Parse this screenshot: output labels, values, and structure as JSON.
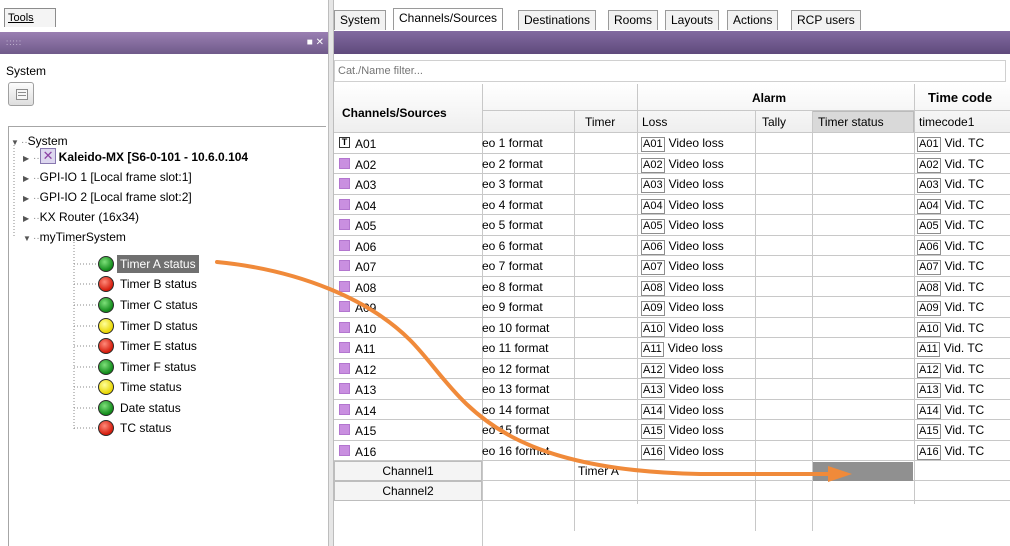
{
  "left_panel": {
    "tools_label": "Tools",
    "system_label": "System",
    "tree": {
      "root": "System",
      "items": [
        {
          "label": "Kaleido-MX [S6-0-101 - 10.6.0.104",
          "bold": true
        },
        {
          "label": "GPI-IO 1 [Local frame slot:1]"
        },
        {
          "label": "GPI-IO 2 [Local frame slot:2]"
        },
        {
          "label": "KX Router (16x34)"
        },
        {
          "label": "myTimerSystem"
        }
      ],
      "timers": [
        {
          "label": "Timer A status",
          "color": "green",
          "selected": true
        },
        {
          "label": "Timer B status",
          "color": "red"
        },
        {
          "label": "Timer C status",
          "color": "green"
        },
        {
          "label": "Timer D status",
          "color": "yellow"
        },
        {
          "label": "Timer E status",
          "color": "red"
        },
        {
          "label": "Timer F status",
          "color": "green"
        },
        {
          "label": "Time status",
          "color": "yellow"
        },
        {
          "label": "Date status",
          "color": "green"
        },
        {
          "label": "TC status",
          "color": "red"
        }
      ]
    }
  },
  "tabs": [
    "System",
    "Channels/Sources",
    "Destinations",
    "Rooms",
    "Layouts",
    "Actions",
    "RCP users"
  ],
  "active_tab": "Channels/Sources",
  "filter_placeholder": "Cat./Name filter...",
  "grid": {
    "headers": {
      "channels": "Channels/Sources",
      "alarm": "Alarm",
      "time_code": "Time code",
      "timer": "Timer",
      "loss": "Loss",
      "tally": "Tally",
      "timer_status": "Timer status",
      "timecode1": "timecode1"
    },
    "rows": [
      {
        "channel": "A01",
        "icon": "T",
        "format": "eo 1 format",
        "loss_id": "A01",
        "loss": "Video loss",
        "tc_id": "A01",
        "tc": "Vid. TC"
      },
      {
        "channel": "A02",
        "format": "eo 2 format",
        "loss_id": "A02",
        "loss": "Video loss",
        "tc_id": "A02",
        "tc": "Vid. TC"
      },
      {
        "channel": "A03",
        "format": "eo 3 format",
        "loss_id": "A03",
        "loss": "Video loss",
        "tc_id": "A03",
        "tc": "Vid. TC"
      },
      {
        "channel": "A04",
        "format": "eo 4 format",
        "loss_id": "A04",
        "loss": "Video loss",
        "tc_id": "A04",
        "tc": "Vid. TC"
      },
      {
        "channel": "A05",
        "format": "eo 5 format",
        "loss_id": "A05",
        "loss": "Video loss",
        "tc_id": "A05",
        "tc": "Vid. TC"
      },
      {
        "channel": "A06",
        "format": "eo 6 format",
        "loss_id": "A06",
        "loss": "Video loss",
        "tc_id": "A06",
        "tc": "Vid. TC"
      },
      {
        "channel": "A07",
        "format": "eo 7 format",
        "loss_id": "A07",
        "loss": "Video loss",
        "tc_id": "A07",
        "tc": "Vid. TC"
      },
      {
        "channel": "A08",
        "format": "eo 8 format",
        "loss_id": "A08",
        "loss": "Video loss",
        "tc_id": "A08",
        "tc": "Vid. TC"
      },
      {
        "channel": "A09",
        "format": "eo 9 format",
        "loss_id": "A09",
        "loss": "Video loss",
        "tc_id": "A09",
        "tc": "Vid. TC"
      },
      {
        "channel": "A10",
        "format": "eo 10 format",
        "loss_id": "A10",
        "loss": "Video loss",
        "tc_id": "A10",
        "tc": "Vid. TC"
      },
      {
        "channel": "A11",
        "format": "eo 11 format",
        "loss_id": "A11",
        "loss": "Video loss",
        "tc_id": "A11",
        "tc": "Vid. TC"
      },
      {
        "channel": "A12",
        "format": "eo 12 format",
        "loss_id": "A12",
        "loss": "Video loss",
        "tc_id": "A12",
        "tc": "Vid. TC"
      },
      {
        "channel": "A13",
        "format": "eo 13 format",
        "loss_id": "A13",
        "loss": "Video loss",
        "tc_id": "A13",
        "tc": "Vid. TC"
      },
      {
        "channel": "A14",
        "format": "eo 14 format",
        "loss_id": "A14",
        "loss": "Video loss",
        "tc_id": "A14",
        "tc": "Vid. TC"
      },
      {
        "channel": "A15",
        "format": "eo 15 format",
        "loss_id": "A15",
        "loss": "Video loss",
        "tc_id": "A15",
        "tc": "Vid. TC"
      },
      {
        "channel": "A16",
        "format": "eo 16 format",
        "loss_id": "A16",
        "loss": "Video loss",
        "tc_id": "A16",
        "tc": "Vid. TC"
      }
    ],
    "extra_rows": [
      {
        "channel": "Channel1",
        "timer": "Timer A"
      },
      {
        "channel": "Channel2",
        "timer": ""
      }
    ]
  },
  "colors": {
    "titlebar": "#6f5a8a",
    "channel_square": "#c98fe0",
    "arrow": "#f08a3a",
    "selection": "#707070"
  }
}
